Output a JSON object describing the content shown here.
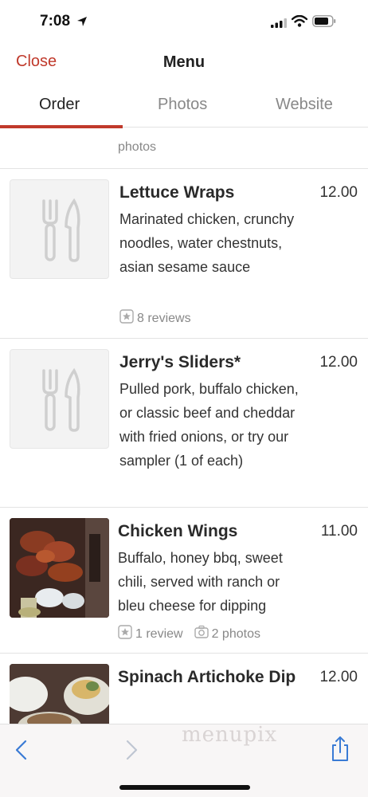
{
  "status_bar": {
    "time": "7:08"
  },
  "nav": {
    "close_label": "Close",
    "title": "Menu"
  },
  "tabs": [
    {
      "label": "Order",
      "active": true
    },
    {
      "label": "Photos",
      "active": false
    },
    {
      "label": "Website",
      "active": false
    }
  ],
  "partial_item": {
    "photos_label": "photos"
  },
  "items": [
    {
      "name": "Lettuce Wraps",
      "price": "12.00",
      "description": "Marinated chicken, crunchy noodles, water chestnuts, asian sesame sauce",
      "reviews": "8 reviews",
      "photos": ""
    },
    {
      "name": "Jerry's Sliders*",
      "price": "12.00",
      "description": "Pulled pork, buffalo chicken, or classic beef and cheddar with fried onions, or try our sampler (1 of each)",
      "reviews": "",
      "photos": ""
    },
    {
      "name": "Chicken Wings",
      "price": "11.00",
      "description": "Buffalo, honey bbq, sweet chili, served with ranch or bleu cheese for dipping",
      "reviews": "1 review",
      "photos": "2 photos"
    },
    {
      "name": "Spinach Artichoke Dip",
      "price": "12.00",
      "description": "",
      "reviews": "",
      "photos": ""
    }
  ],
  "bottom_bar": {
    "watermark": "menupix"
  },
  "colors": {
    "accent": "#c0392b",
    "divider": "#e3e3e3",
    "muted": "#888888"
  },
  "icons": [
    "location-arrow-icon",
    "signal-icon",
    "wifi-icon",
    "battery-icon",
    "fork-knife-icon",
    "star-icon",
    "camera-icon",
    "back-chevron-icon",
    "forward-chevron-icon",
    "share-icon"
  ]
}
